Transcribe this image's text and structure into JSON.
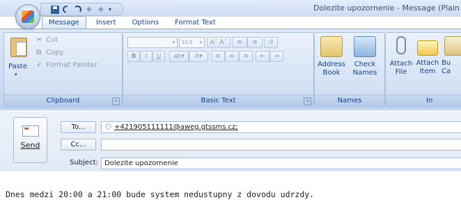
{
  "window": {
    "title": "Dolezite upozornenie - Message (Plain T"
  },
  "quick_access": {
    "icons": [
      "save-icon",
      "undo-icon",
      "redo-icon",
      "arrow-up-icon",
      "arrow-down-icon",
      "customize-dropdown-icon"
    ],
    "dropdown_glyph": "▾"
  },
  "tabs": [
    {
      "label": "Message",
      "active": true
    },
    {
      "label": "Insert",
      "active": false
    },
    {
      "label": "Options",
      "active": false
    },
    {
      "label": "Format Text",
      "active": false
    }
  ],
  "ribbon": {
    "clipboard": {
      "title": "Clipboard",
      "paste": "Paste",
      "cut": "Cut",
      "copy": "Copy",
      "format_painter": "Format Painter"
    },
    "basic_text": {
      "title": "Basic Text",
      "font_name": "",
      "font_size": "10,5",
      "bold": "B",
      "italic": "I",
      "underline": "U"
    },
    "names": {
      "title": "Names",
      "address_book_line1": "Address",
      "address_book_line2": "Book",
      "check_names_line1": "Check",
      "check_names_line2": "Names"
    },
    "include": {
      "title": "In",
      "attach_file_line1": "Attach",
      "attach_file_line2": "File",
      "attach_item_line1": "Attach",
      "attach_item_line2": "Item",
      "business_card_line1": "Bu",
      "business_card_line2": "Ca"
    }
  },
  "compose": {
    "send_label": "Send",
    "to_button": "To...",
    "cc_button": "Cc...",
    "subject_label": "Subject:",
    "to_value": "+421905111111@aweg.gtssms.cz;",
    "cc_value": "",
    "subject_value": "Dolezite upozornenie",
    "body": "Dnes medzi 20:00 a 21:00 bude system nedustupny z dovodu udrzdy."
  },
  "colors": {
    "ribbon_text": "#15428b",
    "ribbon_bg": "#d3e1f3",
    "accent_orange": "#f5a623"
  }
}
